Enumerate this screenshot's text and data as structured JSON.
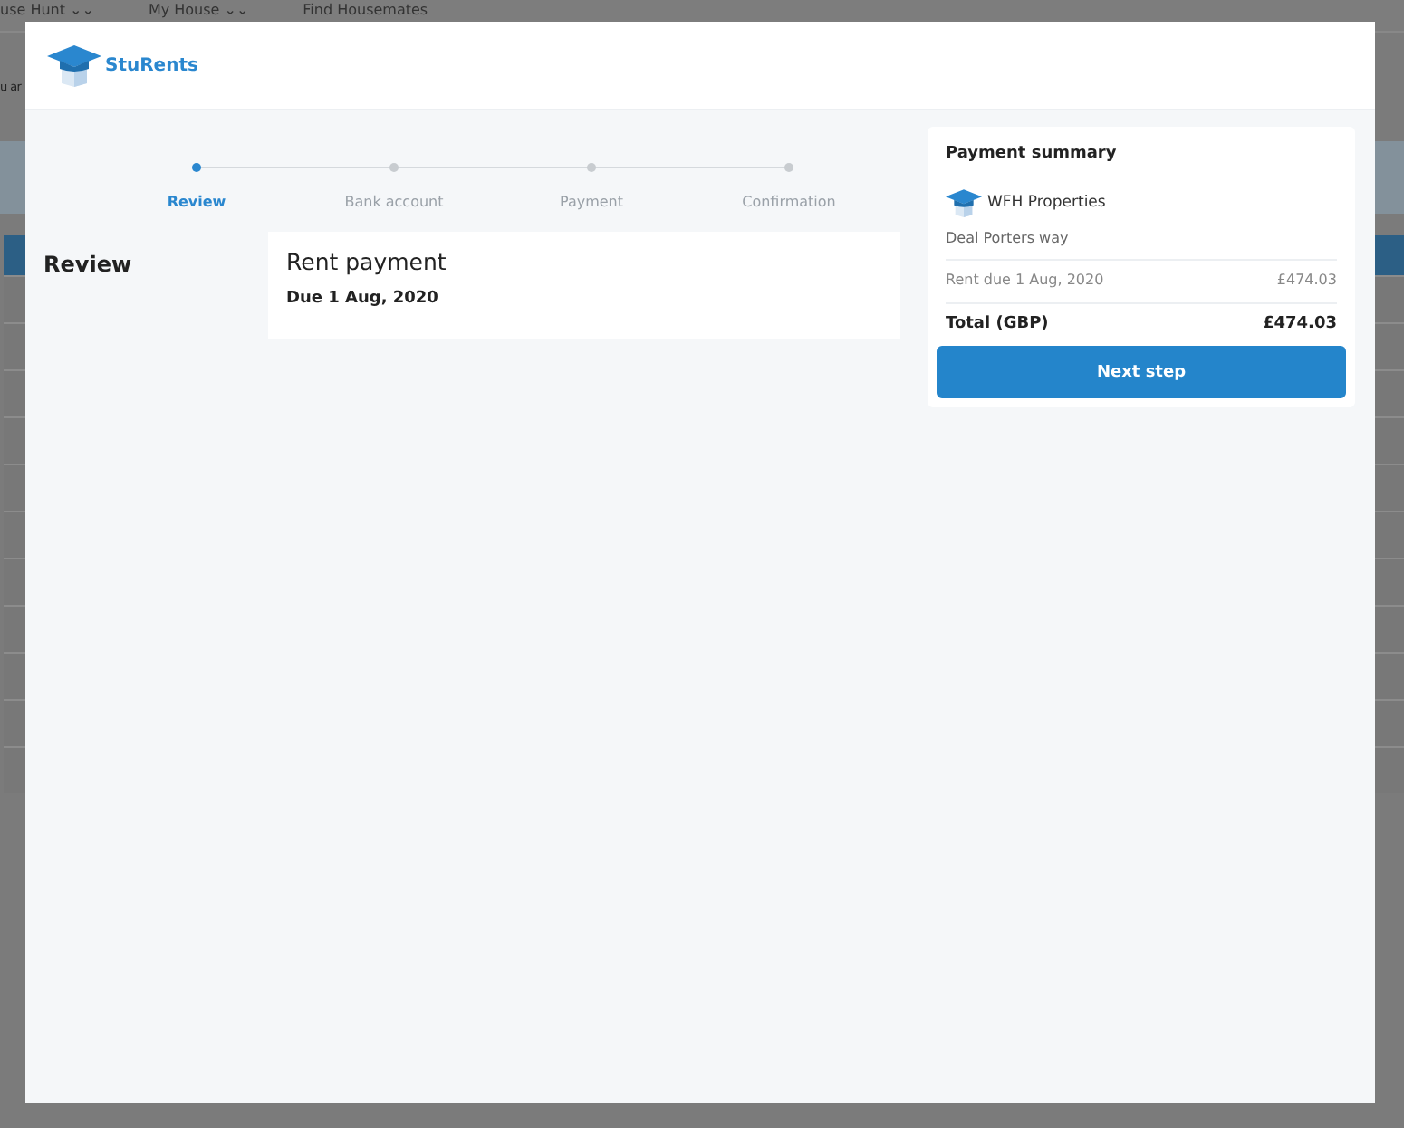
{
  "background_page": {
    "nav": [
      "use Hunt ⌄⌄",
      "My House ⌄⌄",
      "Find Housemates"
    ],
    "notice": "u ar"
  },
  "modal": {
    "brand": "StuRents",
    "steps": [
      {
        "label": "Review",
        "selected": true
      },
      {
        "label": "Bank account",
        "selected": false
      },
      {
        "label": "Payment",
        "selected": false
      },
      {
        "label": "Confirmation",
        "selected": false
      }
    ],
    "section_title": "Review",
    "payment_card": {
      "title": "Rent payment",
      "due": "Due 1 Aug, 2020"
    },
    "summary": {
      "title": "Payment summary",
      "landlord": "WFH Properties",
      "address": "Deal Porters way",
      "line": {
        "label": "Rent due 1 Aug, 2020",
        "amount": "£474.03"
      },
      "total": {
        "label": "Total (GBP)",
        "amount": "£474.03"
      },
      "button": "Next step"
    }
  }
}
